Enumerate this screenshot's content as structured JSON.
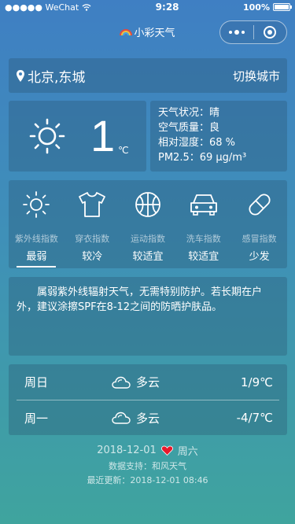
{
  "status_bar": {
    "carrier": "●●●●● WeChat",
    "time": "9:28",
    "battery": "100%"
  },
  "nav": {
    "title": "小彩天气"
  },
  "location": {
    "city": "北京,东城",
    "switch_label": "切换城市"
  },
  "current": {
    "temperature": "1",
    "unit": "℃",
    "icon": "sun-icon",
    "details": [
      "天气状况：晴",
      "空气质量：良",
      "相对湿度：68 %",
      "PM2.5：69 μg/m³"
    ]
  },
  "indices": [
    {
      "label": "紫外线指数",
      "value": "最弱",
      "icon": "uv-sun-icon",
      "active": true
    },
    {
      "label": "穿衣指数",
      "value": "较冷",
      "icon": "tshirt-icon"
    },
    {
      "label": "运动指数",
      "value": "较适宜",
      "icon": "basketball-icon"
    },
    {
      "label": "洗车指数",
      "value": "较适宜",
      "icon": "car-icon"
    },
    {
      "label": "感冒指数",
      "value": "少发",
      "icon": "pill-icon"
    }
  ],
  "advice": "属弱紫外线辐射天气，无需特别防护。若长期在户外，建议涂擦SPF在8-12之间的防晒护肤品。",
  "forecast": [
    {
      "day": "周日",
      "weather": "多云",
      "icon": "cloud-icon",
      "temp": "1/9℃"
    },
    {
      "day": "周一",
      "weather": "多云",
      "icon": "cloud-icon",
      "temp": "-4/7℃"
    }
  ],
  "footer": {
    "date": "2018-12-01",
    "weekday": "周六",
    "source": "数据支持：和风天气",
    "updated": "最近更新：2018-12-01 08:46"
  },
  "colors": {
    "heart": "#e8192c",
    "bg_top": "#3f7fc3",
    "bg_bottom": "#3fa49e"
  }
}
